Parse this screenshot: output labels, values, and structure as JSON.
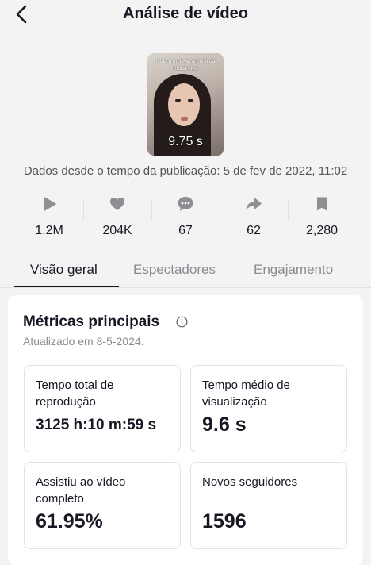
{
  "header": {
    "title": "Análise de vídeo"
  },
  "video": {
    "caption": "o dia q eu levei a trend da morta viva",
    "duration": "9.75 s"
  },
  "since_text": "Dados desde o tempo da publicação: 5 de fev de 2022, 11:02",
  "stats": [
    {
      "icon": "play-icon",
      "value": "1.2M"
    },
    {
      "icon": "heart-icon",
      "value": "204K"
    },
    {
      "icon": "comment-icon",
      "value": "67"
    },
    {
      "icon": "share-icon",
      "value": "62"
    },
    {
      "icon": "bookmark-icon",
      "value": "2,280"
    }
  ],
  "tabs": [
    {
      "label": "Visão geral",
      "active": true
    },
    {
      "label": "Espectadores",
      "active": false
    },
    {
      "label": "Engajamento",
      "active": false
    }
  ],
  "metrics_card": {
    "title": "Métricas principais",
    "updated": "Atualizado em 8-5-2024.",
    "items": [
      {
        "label": "Tempo total de reprodução",
        "value": "3125 h:10 m:59 s"
      },
      {
        "label": "Tempo médio de visualização",
        "value": "9.6 s"
      },
      {
        "label": "Assistiu ao vídeo completo",
        "value": "61.95%"
      },
      {
        "label": "Novos seguidores",
        "value": "1596"
      }
    ]
  },
  "colors": {
    "background": "#f3f3f3",
    "text": "#161823",
    "muted": "#8a8b91",
    "icon_gray": "#8e8e93"
  }
}
